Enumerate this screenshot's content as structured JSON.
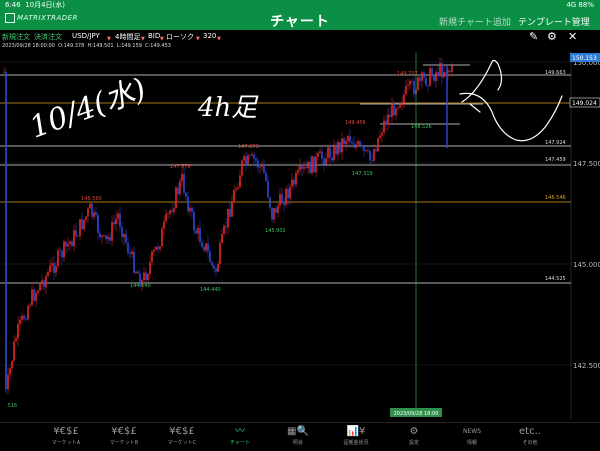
{
  "status": {
    "time": "6:46",
    "date": "10月4日(水)",
    "signal": "4G 88%"
  },
  "header": {
    "logo": "MATRIXTRADER",
    "title": "チャート",
    "add_chart": "新規チャート追加",
    "template": "テンプレート管理"
  },
  "toolbar": {
    "new_order": "新規注文",
    "settle_order": "決済注文",
    "pair": "USD/JPY",
    "interval": "4時間足",
    "side": "BID",
    "chart_type": "ローソク",
    "count": "320"
  },
  "ohlc": {
    "date": "2023/09/28 18:00:00",
    "open": "O:149.378",
    "high": "H:149.501",
    "low": "L:149.159",
    "close": "C:149.453"
  },
  "price_axis": {
    "labels": [
      "150.000",
      "147.500",
      "145.000",
      "142.500"
    ]
  },
  "price_tags": {
    "last": "150.153",
    "current": "149.024"
  },
  "line_labels": [
    "149.663",
    "147.924",
    "147.459",
    "146.546",
    "144.525"
  ],
  "chart_annotations": [
    "149.707",
    "149.456",
    "148.526",
    "147.873",
    "147.576",
    "147.319",
    "146.560",
    "145.902",
    "144.540",
    "144.440",
    ".516"
  ],
  "crosshair_date": "2023/09/28 18:00",
  "handwriting": {
    "date": "10/4(水)",
    "text": "4h足"
  },
  "nav": [
    {
      "icon": "¥€$£",
      "label": "マーケットA"
    },
    {
      "icon": "¥€$£",
      "label": "マーケットB"
    },
    {
      "icon": "¥€$£",
      "label": "マーケットC"
    },
    {
      "icon": "〰",
      "label": "チャート"
    },
    {
      "icon": "▦🔍",
      "label": "照会"
    },
    {
      "icon": "📊¥",
      "label": "証拠金状況"
    },
    {
      "icon": "⚙",
      "label": "設定"
    },
    {
      "icon": "NEWS",
      "label": "情報"
    },
    {
      "icon": "etc..",
      "label": "その他"
    }
  ],
  "colors": {
    "brand": "#0b8f45",
    "up": "#e8272a",
    "down": "#2e4bd6",
    "accent": "#2fd870",
    "price_tag": "#2d7bd6",
    "orange_line": "#e0a020"
  }
}
